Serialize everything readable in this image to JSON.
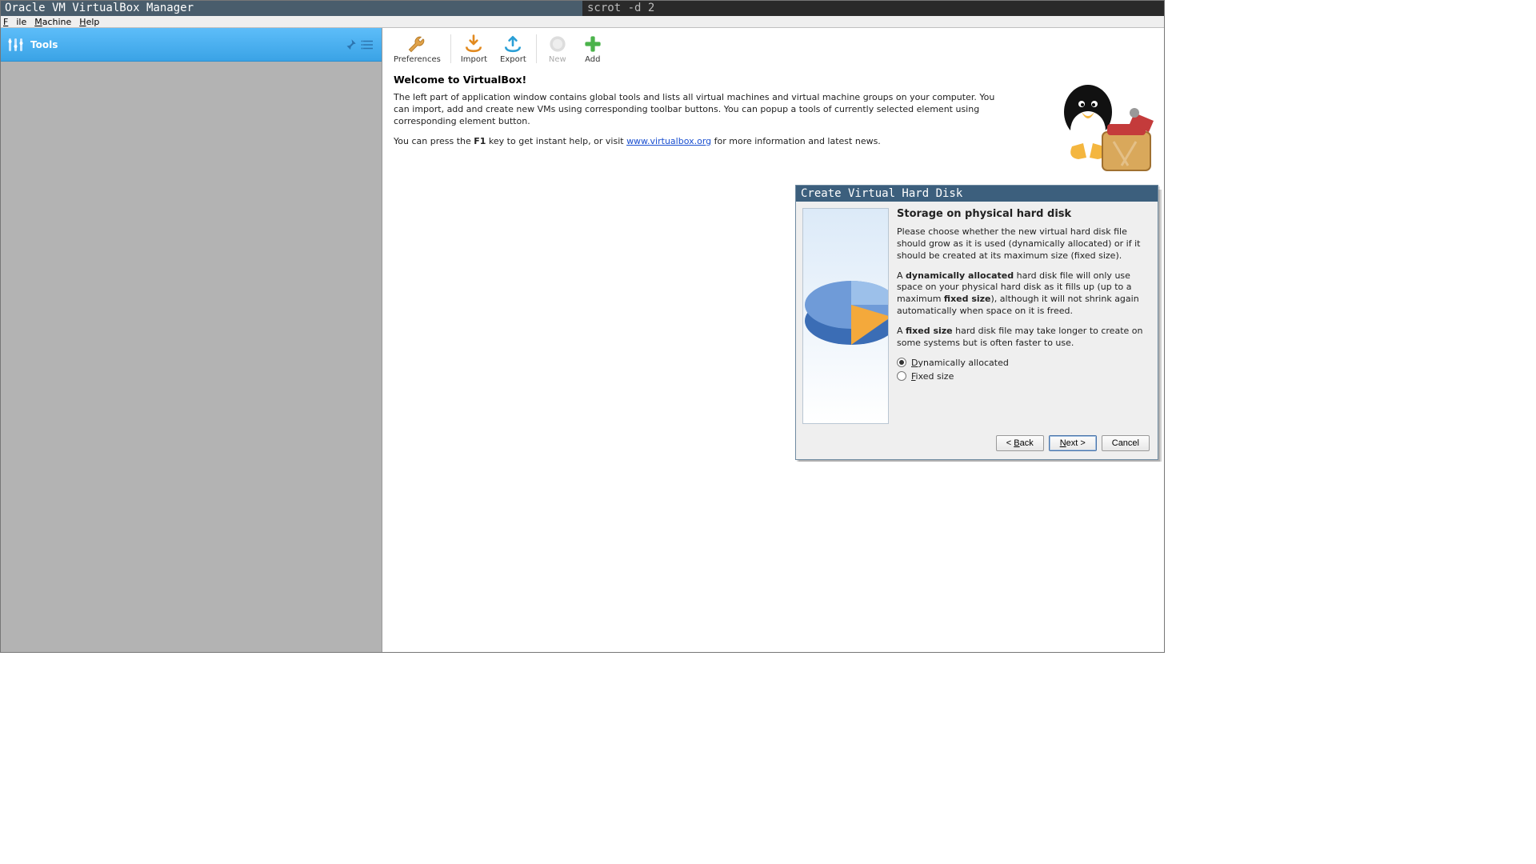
{
  "titlebar": {
    "left": "Oracle VM VirtualBox Manager",
    "right": "scrot -d 2"
  },
  "menu": {
    "file": "File",
    "machine": "Machine",
    "help": "Help"
  },
  "sidebar": {
    "tools": "Tools"
  },
  "toolbar": {
    "preferences": "Preferences",
    "import": "Import",
    "export": "Export",
    "new": "New",
    "add": "Add"
  },
  "welcome": {
    "heading": "Welcome to VirtualBox!",
    "p1": "The left part of application window contains global tools and lists all virtual machines and virtual machine groups on your computer. You can import, add and create new VMs using corresponding toolbar buttons. You can popup a tools of currently selected element using corresponding element button.",
    "p2a": "You can press the ",
    "p2key": "F1",
    "p2b": " key to get instant help, or visit ",
    "p2link": "www.virtualbox.org",
    "p2c": " for more information and latest news."
  },
  "dialog": {
    "title": "Create Virtual Hard Disk",
    "heading": "Storage on physical hard disk",
    "p1": "Please choose whether the new virtual hard disk file should grow as it is used (dynamically allocated) or if it should be created at its maximum size (fixed size).",
    "p2a": "A ",
    "p2b": "dynamically allocated",
    "p2c": " hard disk file will only use space on your physical hard disk as it fills up (up to a maximum ",
    "p2d": "fixed size",
    "p2e": "), although it will not shrink again automatically when space on it is freed.",
    "p3a": "A ",
    "p3b": "fixed size",
    "p3c": " hard disk file may take longer to create on some systems but is often faster to use.",
    "opt_dyn": "Dynamically allocated",
    "opt_fix": "Fixed size",
    "back": "< Back",
    "next": "Next >",
    "cancel": "Cancel"
  }
}
